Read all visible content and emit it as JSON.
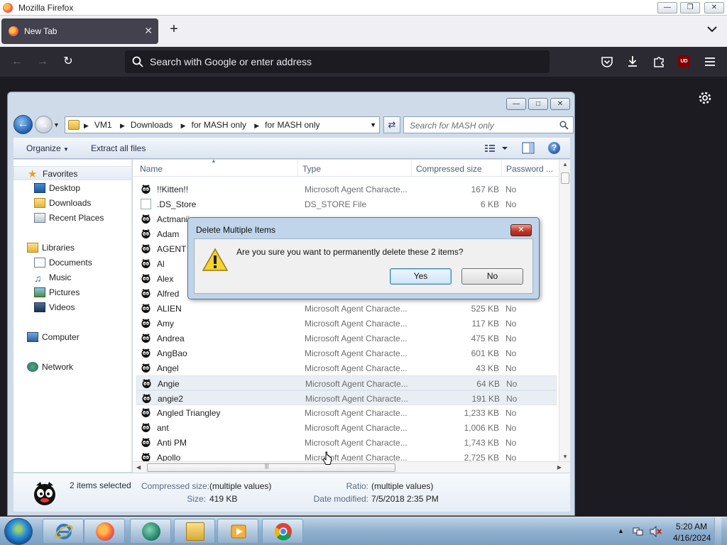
{
  "firefox": {
    "window_title": "Mozilla Firefox",
    "tab_label": "New Tab",
    "url_placeholder": "Search with Google or enter address",
    "ublock_badge": "UD"
  },
  "explorer": {
    "breadcrumb": [
      "VM1",
      "Downloads",
      "for MASH only",
      "for MASH only"
    ],
    "search_placeholder": "Search for MASH only",
    "toolbar": {
      "organize": "Organize",
      "extract": "Extract all files"
    },
    "nav": {
      "favorites": "Favorites",
      "favorites_items": [
        "Desktop",
        "Downloads",
        "Recent Places"
      ],
      "libraries": "Libraries",
      "libraries_items": [
        "Documents",
        "Music",
        "Pictures",
        "Videos"
      ],
      "computer": "Computer",
      "network": "Network"
    },
    "columns": {
      "name": "Name",
      "type": "Type",
      "compressed": "Compressed size",
      "password": "Password ..."
    },
    "files": [
      {
        "name": "!!Kitten!!",
        "type": "Microsoft Agent Characte...",
        "size": "167 KB",
        "password": "No"
      },
      {
        "name": ".DS_Store",
        "type": "DS_STORE File",
        "size": "6 KB",
        "password": "No"
      },
      {
        "name": "Actmanii",
        "type": "",
        "size": "",
        "password": ""
      },
      {
        "name": "Adam",
        "type": "",
        "size": "",
        "password": ""
      },
      {
        "name": "AGENT",
        "type": "",
        "size": "",
        "password": ""
      },
      {
        "name": "Al",
        "type": "",
        "size": "",
        "password": ""
      },
      {
        "name": "Alex",
        "type": "",
        "size": "",
        "password": ""
      },
      {
        "name": "Alfred",
        "type": "",
        "size": "",
        "password": ""
      },
      {
        "name": "ALIEN",
        "type": "Microsoft Agent Characte...",
        "size": "525 KB",
        "password": "No"
      },
      {
        "name": "Amy",
        "type": "Microsoft Agent Characte...",
        "size": "117 KB",
        "password": "No"
      },
      {
        "name": "Andrea",
        "type": "Microsoft Agent Characte...",
        "size": "475 KB",
        "password": "No"
      },
      {
        "name": "AngBao",
        "type": "Microsoft Agent Characte...",
        "size": "601 KB",
        "password": "No"
      },
      {
        "name": "Angel",
        "type": "Microsoft Agent Characte...",
        "size": "43 KB",
        "password": "No"
      },
      {
        "name": "Angie",
        "type": "Microsoft Agent Characte...",
        "size": "64 KB",
        "password": "No",
        "selected": true
      },
      {
        "name": "angie2",
        "type": "Microsoft Agent Characte...",
        "size": "191 KB",
        "password": "No",
        "selected": true
      },
      {
        "name": "Angled Triangley",
        "type": "Microsoft Agent Characte...",
        "size": "1,233 KB",
        "password": "No"
      },
      {
        "name": "ant",
        "type": "Microsoft Agent Characte...",
        "size": "1,006 KB",
        "password": "No"
      },
      {
        "name": "Anti PM",
        "type": "Microsoft Agent Characte...",
        "size": "1,743 KB",
        "password": "No"
      },
      {
        "name": "Apollo",
        "type": "Microsoft Agent Characte...",
        "size": "2,725 KB",
        "password": "No"
      }
    ],
    "details": {
      "selection": "2 items selected",
      "compressed_label": "Compressed size:",
      "compressed_value": "(multiple values)",
      "size_label": "Size:",
      "size_value": "419 KB",
      "ratio_label": "Ratio:",
      "ratio_value": "(multiple values)",
      "date_label": "Date modified:",
      "date_value": "7/5/2018 2:35 PM"
    }
  },
  "dialog": {
    "title": "Delete Multiple Items",
    "message": "Are you sure you want to permanently delete these 2 items?",
    "yes": "Yes",
    "no": "No"
  },
  "taskbar": {
    "time": "5:20 AM",
    "date": "4/16/2024"
  },
  "colors": {
    "firefox_toolbar": "#2b2a33",
    "explorer_frame": "#cfdbe9",
    "selection": "#e9eef5",
    "taskbar": "#8fb0cf"
  }
}
